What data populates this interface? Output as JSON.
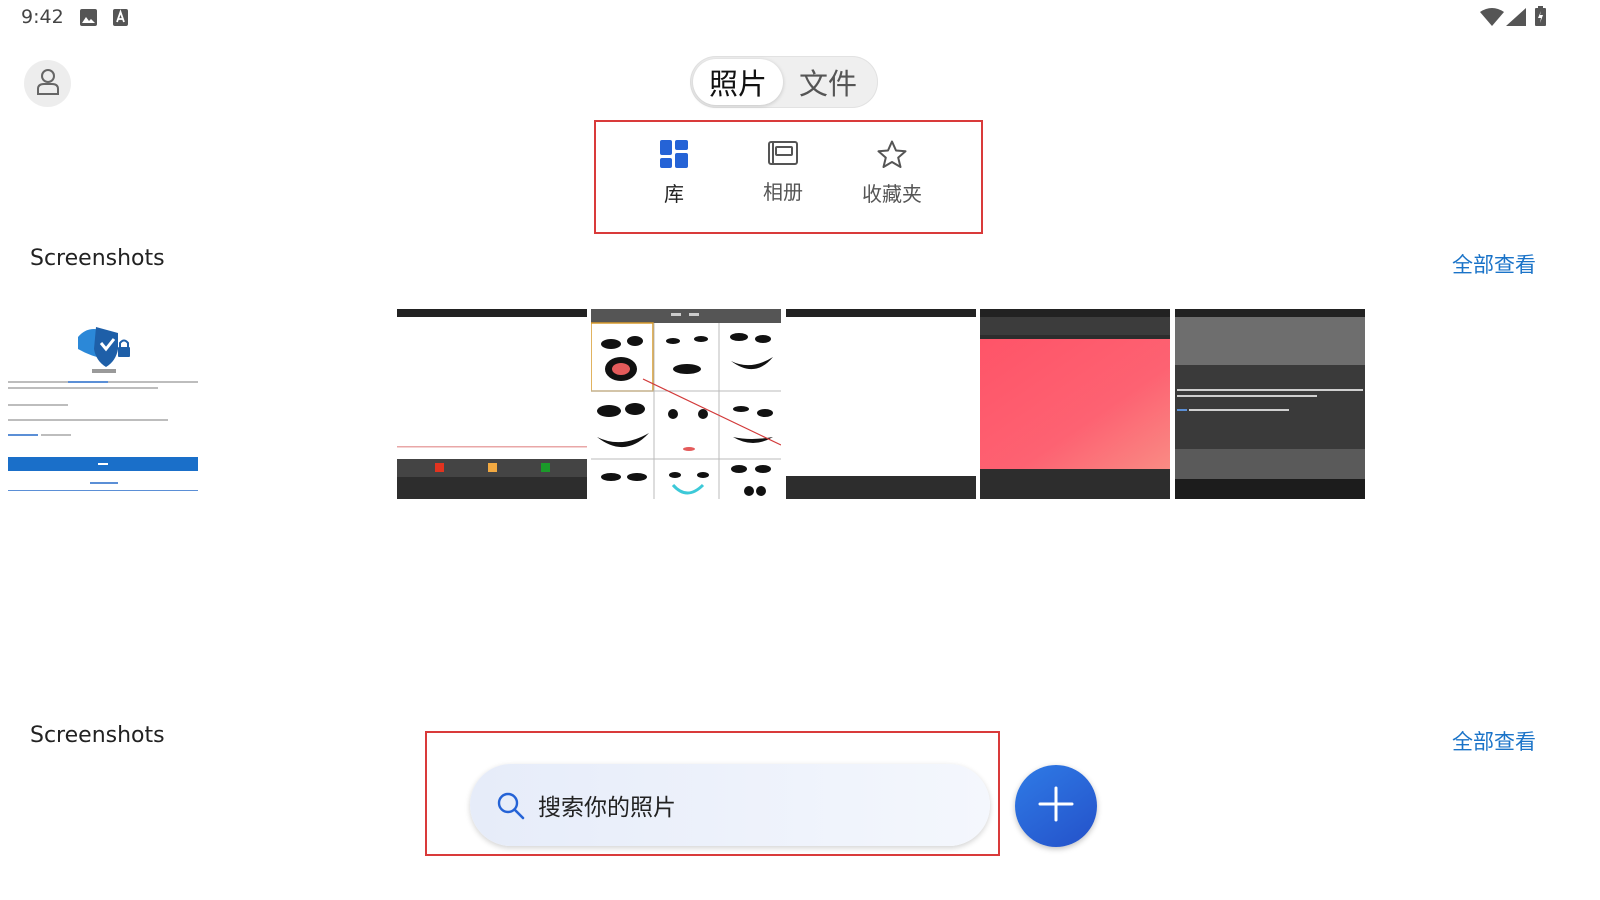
{
  "status_bar": {
    "time": "9:42",
    "left_icons": [
      "image-icon",
      "text-a-icon"
    ],
    "right_icons": [
      "wifi-icon",
      "signal-icon",
      "battery-icon"
    ]
  },
  "header": {
    "account_icon": "account-icon",
    "segments": [
      {
        "label": "照片",
        "selected": true
      },
      {
        "label": "文件",
        "selected": false
      }
    ]
  },
  "sub_tabs": [
    {
      "label": "库",
      "icon": "library-grid-icon",
      "selected": true
    },
    {
      "label": "相册",
      "icon": "album-icon",
      "selected": false
    },
    {
      "label": "收藏夹",
      "icon": "star-icon",
      "selected": false
    }
  ],
  "sections": [
    {
      "title": "Screenshots",
      "view_all": "全部查看",
      "thumbnails": [
        "screenshot-thumbnail-1",
        "screenshot-thumbnail-2",
        "screenshot-thumbnail-3",
        "screenshot-thumbnail-4",
        "screenshot-thumbnail-5",
        "screenshot-thumbnail-6",
        "screenshot-thumbnail-7"
      ]
    },
    {
      "title": "Screenshots",
      "view_all": "全部查看"
    }
  ],
  "search": {
    "placeholder": "搜索你的照片",
    "icon": "search-icon"
  },
  "fab": {
    "icon": "plus-icon"
  },
  "colors": {
    "accent": "#2563d6",
    "link": "#1a73c8",
    "highlight": "#d93a3a"
  }
}
